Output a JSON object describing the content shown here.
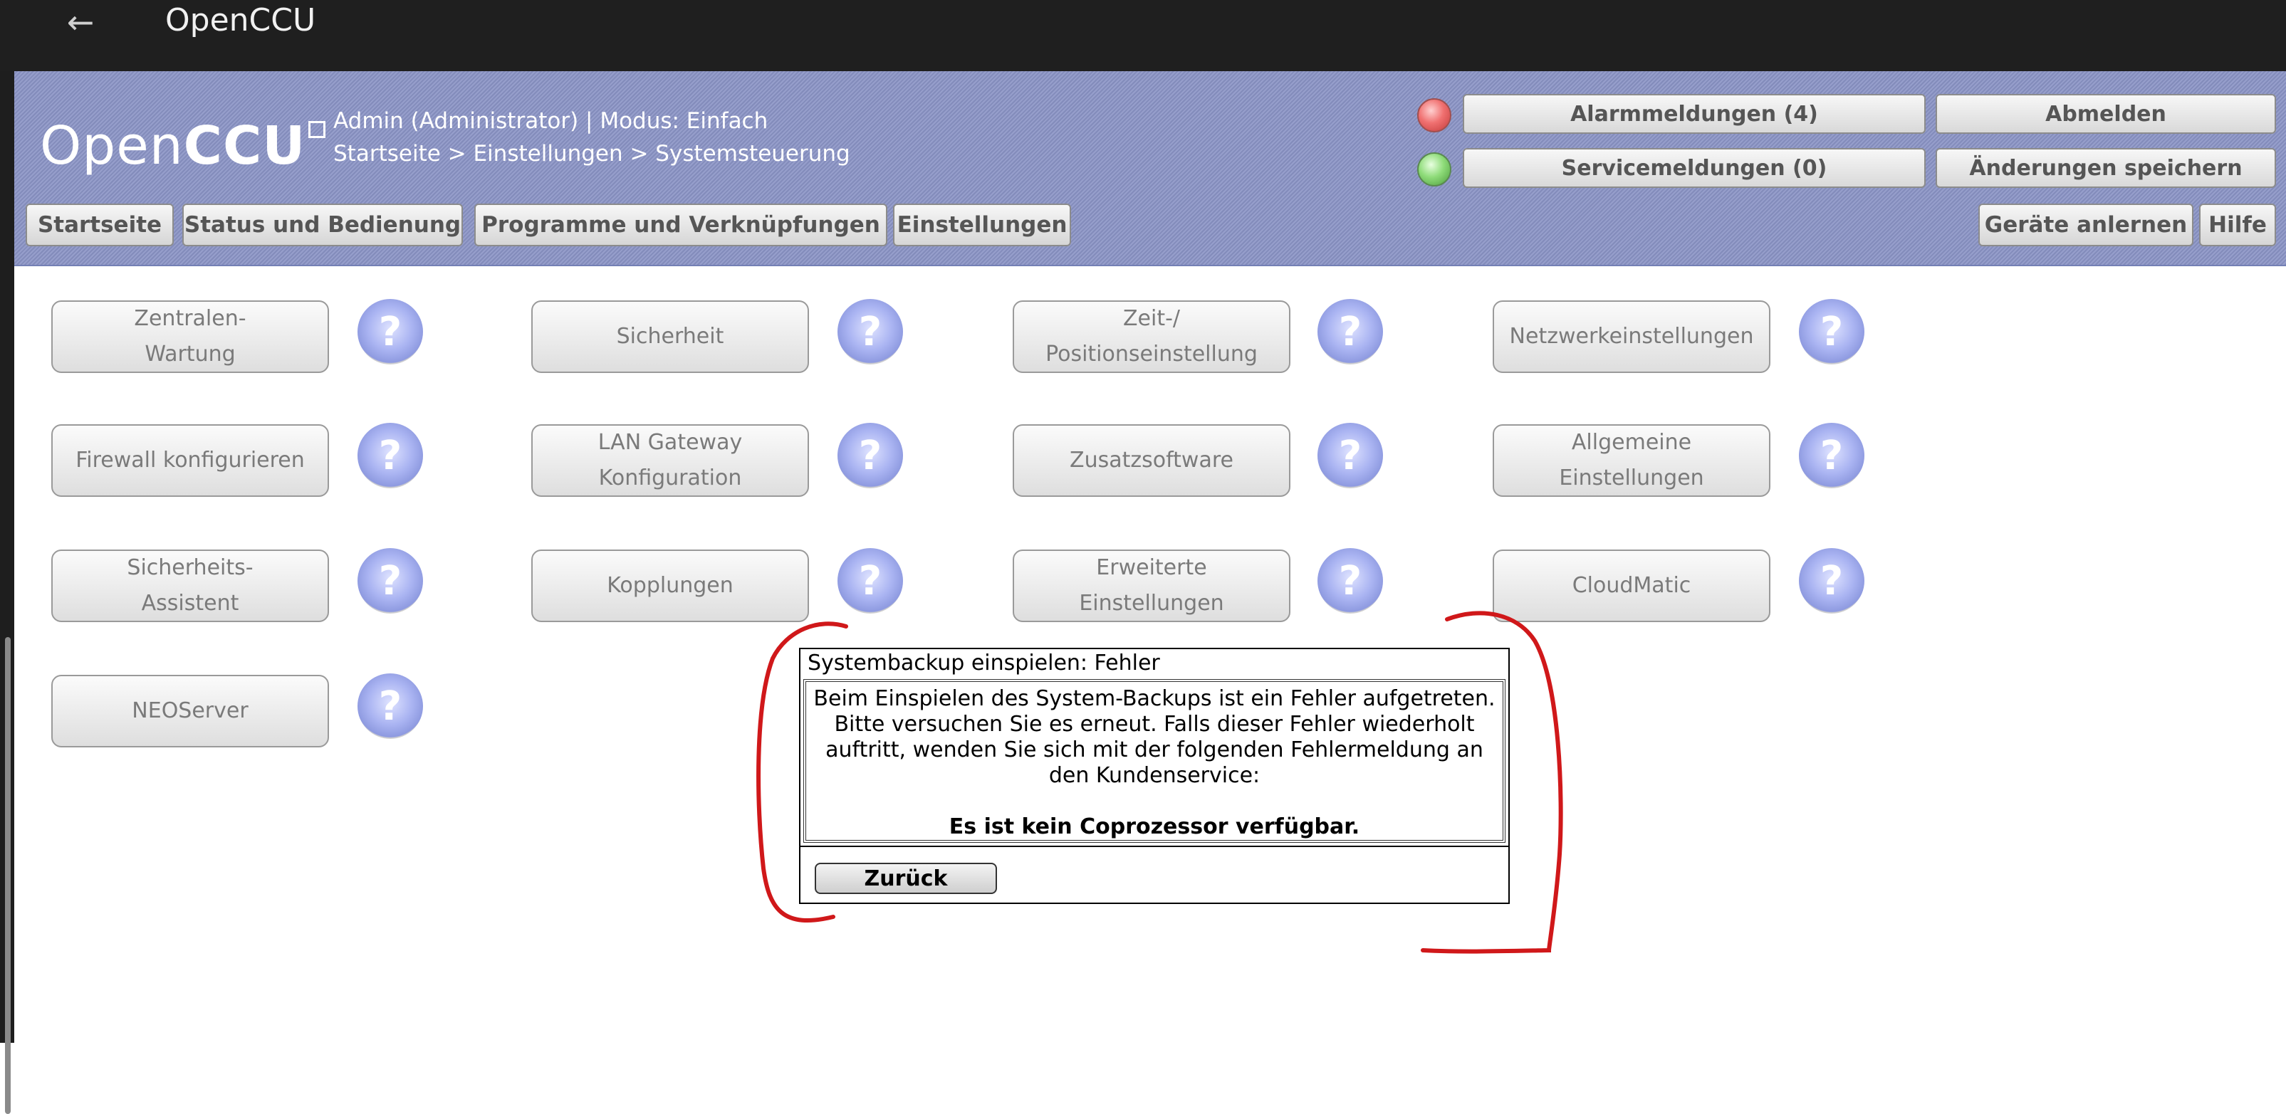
{
  "browser": {
    "title": "OpenCCU",
    "back_symbol": "←"
  },
  "header": {
    "logo_thin": "Open",
    "logo_bold": "CCU",
    "user_line": "Admin (Administrator) | Modus: Einfach",
    "breadcrumb": "Startseite > Einstellungen > Systemsteuerung",
    "alarm_button": "Alarmmeldungen (4)",
    "logout_button": "Abmelden",
    "service_button": "Servicemeldungen (0)",
    "save_button": "Änderungen speichern",
    "led_alarm_color": "#e05a5a",
    "led_service_color": "#7dcc6a"
  },
  "nav": {
    "start": "Startseite",
    "status": "Status und Bedienung",
    "programs": "Programme und Verknüpfungen",
    "settings": "Einstellungen",
    "learn": "Geräte anlernen",
    "help": "Hilfe"
  },
  "tiles": [
    {
      "l1": "Zentralen-",
      "l2": "Wartung"
    },
    {
      "l1": "Sicherheit",
      "l2": ""
    },
    {
      "l1": "Zeit-/",
      "l2": "Positionseinstellung"
    },
    {
      "l1": "Netzwerkeinstellungen",
      "l2": ""
    },
    {
      "l1": "Firewall konfigurieren",
      "l2": ""
    },
    {
      "l1": "LAN Gateway",
      "l2": "Konfiguration"
    },
    {
      "l1": "Zusatzsoftware",
      "l2": ""
    },
    {
      "l1": "Allgemeine",
      "l2": "Einstellungen"
    },
    {
      "l1": "Sicherheits-",
      "l2": "Assistent"
    },
    {
      "l1": "Kopplungen",
      "l2": ""
    },
    {
      "l1": "Erweiterte",
      "l2": "Einstellungen"
    },
    {
      "l1": "CloudMatic",
      "l2": ""
    },
    {
      "l1": "NEOServer",
      "l2": ""
    }
  ],
  "help_glyph": "?",
  "dialog": {
    "title": "Systembackup einspielen: Fehler",
    "line1": "Beim Einspielen des System-Backups ist ein Fehler aufgetreten.",
    "line2": "Bitte versuchen Sie es erneut. Falls dieser Fehler wiederholt",
    "line3": "auftritt, wenden Sie sich mit der folgenden Fehlermeldung an",
    "line4": "den Kundenservice:",
    "error": "Es ist kein Coprozessor verfügbar.",
    "back_button": "Zurück"
  },
  "colors": {
    "header_bg": "#8a93c5",
    "annotation": "#d0181a"
  }
}
